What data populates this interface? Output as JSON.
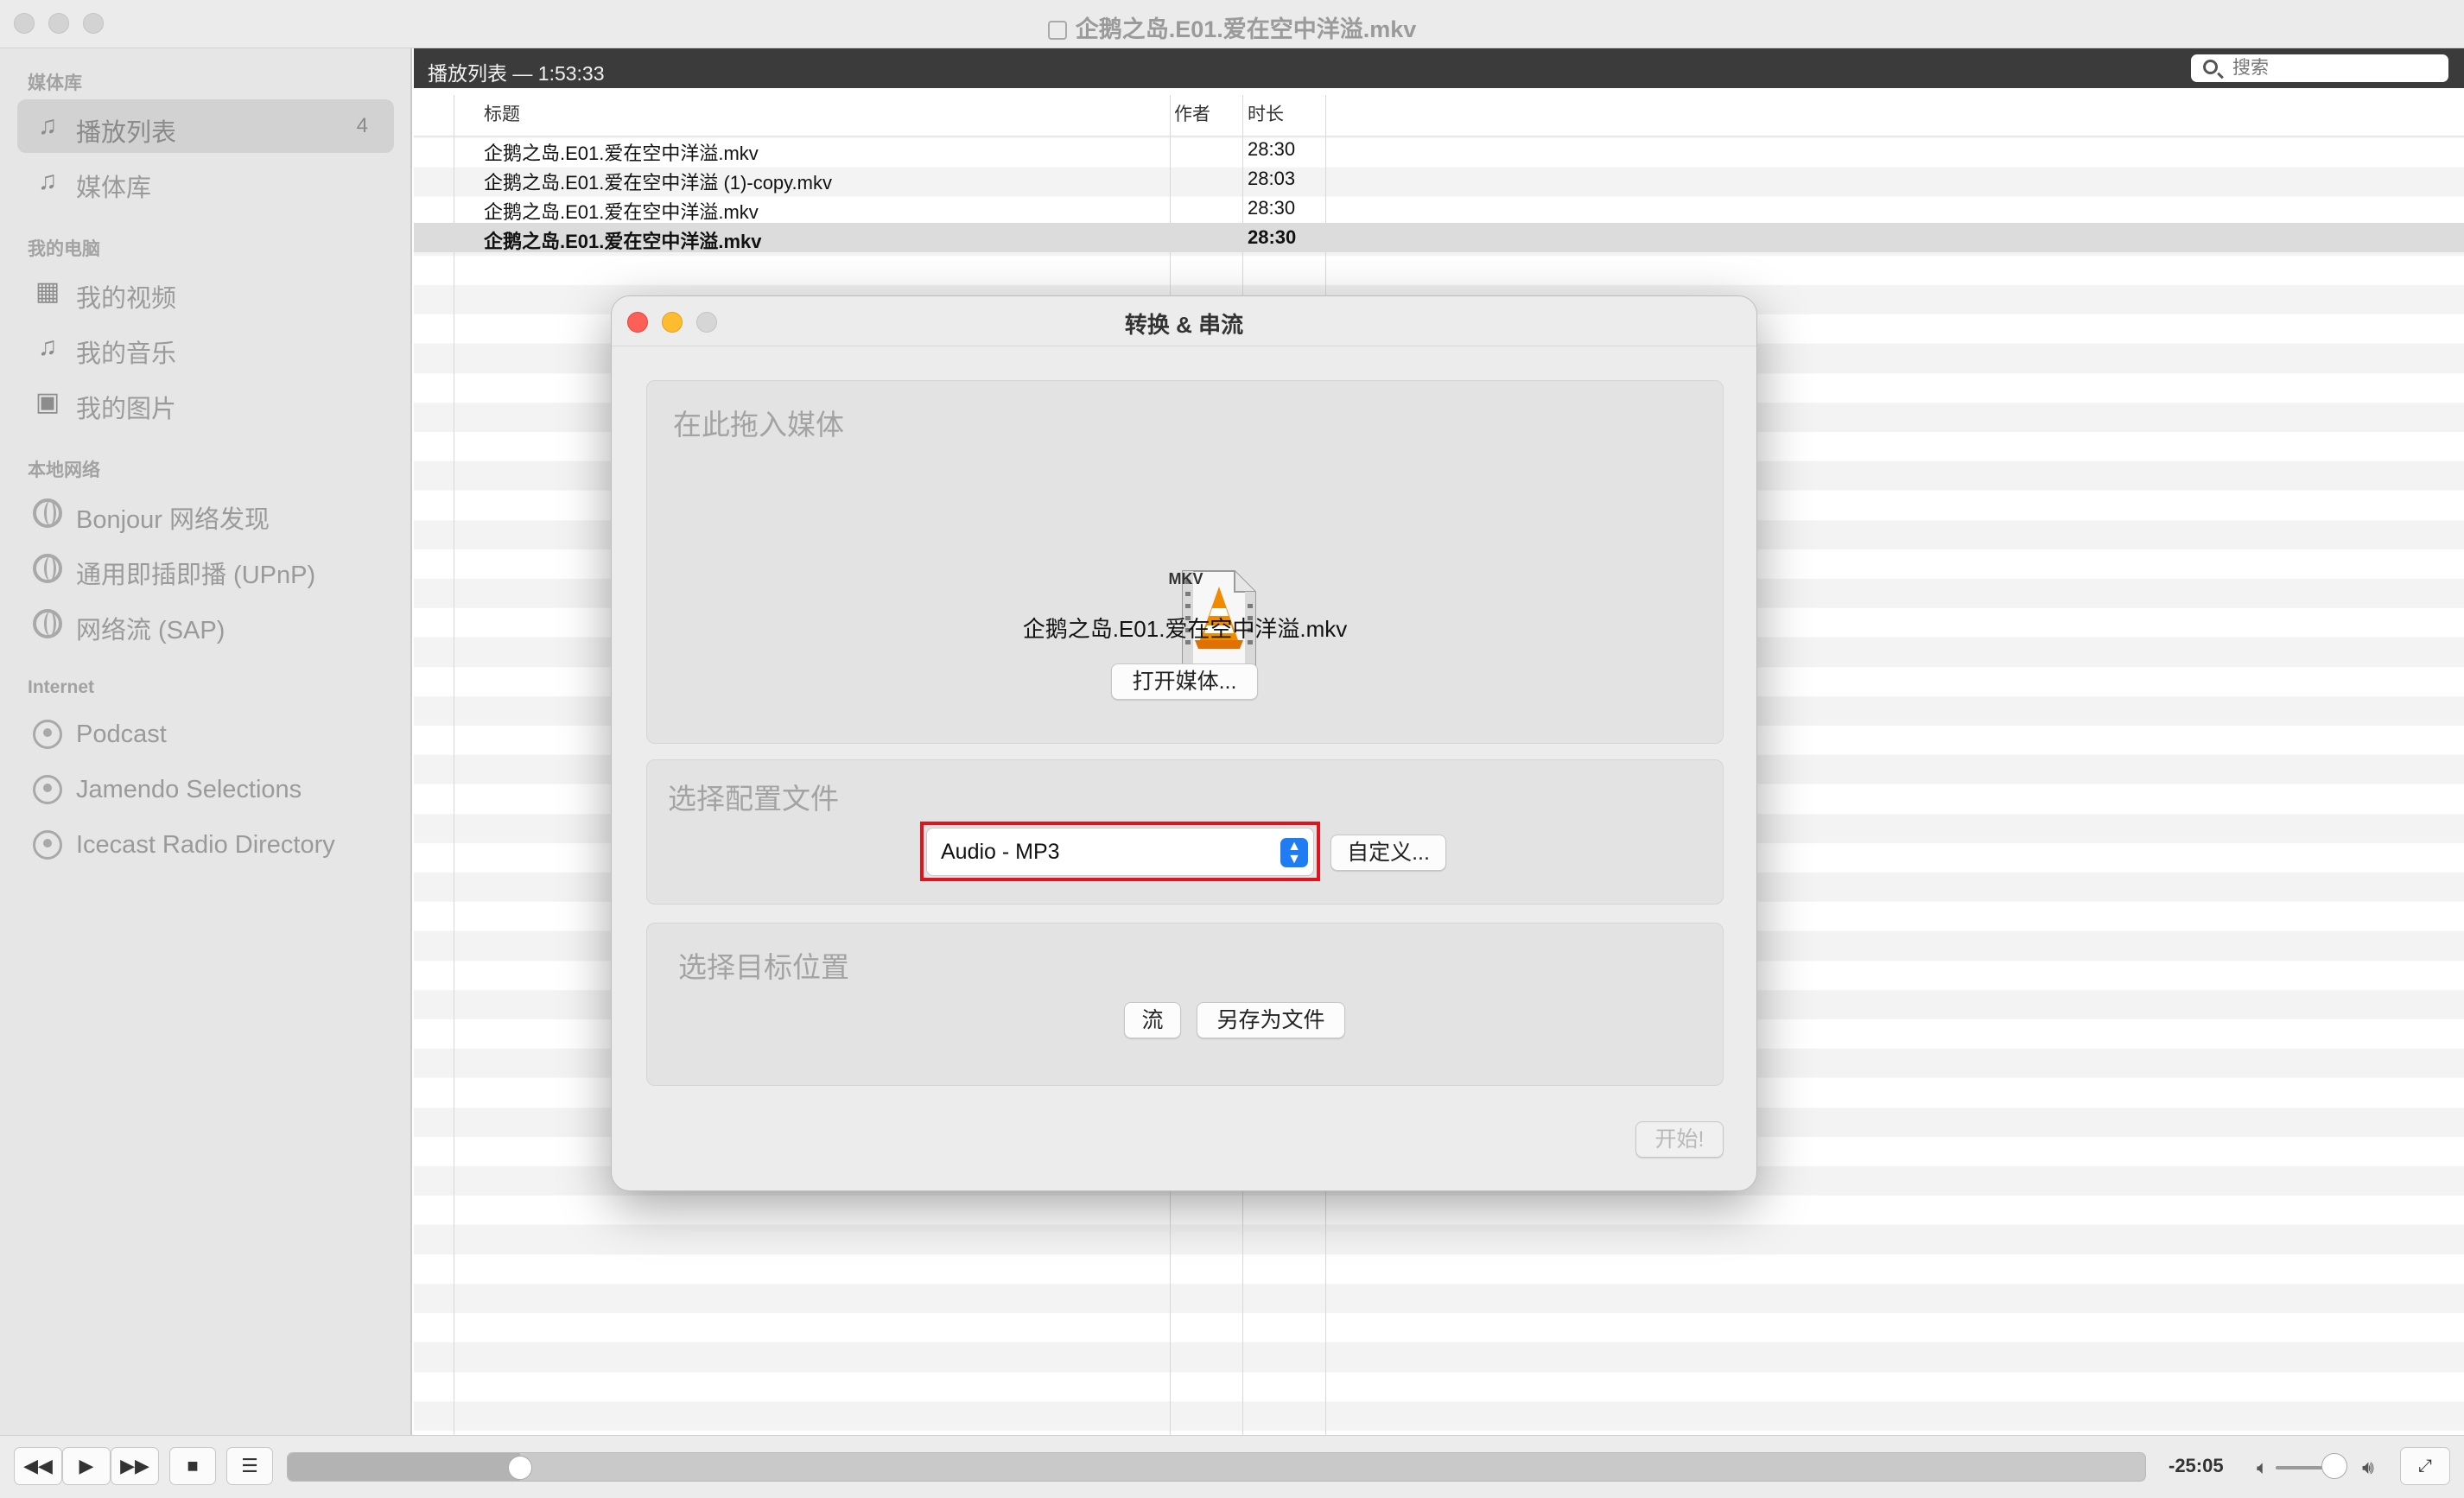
{
  "window": {
    "title": "企鹅之岛.E01.爱在空中洋溢.mkv"
  },
  "sidebar": {
    "sections": [
      {
        "heading": "媒体库",
        "items": [
          {
            "label": "播放列表",
            "icon": "music-note-doc-icon",
            "count": "4",
            "active": true
          },
          {
            "label": "媒体库",
            "icon": "music-note-doc-icon"
          }
        ]
      },
      {
        "heading": "我的电脑",
        "items": [
          {
            "label": "我的视频",
            "icon": "film-icon"
          },
          {
            "label": "我的音乐",
            "icon": "music-note-icon"
          },
          {
            "label": "我的图片",
            "icon": "picture-icon"
          }
        ]
      },
      {
        "heading": "本地网络",
        "items": [
          {
            "label": "Bonjour 网络发现",
            "icon": "globe-icon"
          },
          {
            "label": "通用即插即播 (UPnP)",
            "icon": "globe-icon"
          },
          {
            "label": "网络流 (SAP)",
            "icon": "globe-icon"
          }
        ]
      },
      {
        "heading": "Internet",
        "items": [
          {
            "label": "Podcast",
            "icon": "podcast-icon"
          },
          {
            "label": "Jamendo Selections",
            "icon": "podcast-icon"
          },
          {
            "label": "Icecast Radio Directory",
            "icon": "podcast-icon"
          }
        ]
      }
    ]
  },
  "playlist": {
    "header_title": "播放列表 — 1:53:33",
    "search_placeholder": "搜索",
    "columns": {
      "title": "标题",
      "author": "作者",
      "duration": "时长"
    },
    "rows": [
      {
        "title": "企鹅之岛.E01.爱在空中洋溢.mkv",
        "author": "",
        "duration": "28:30",
        "selected": false
      },
      {
        "title": "企鹅之岛.E01.爱在空中洋溢 (1)-copy.mkv",
        "author": "",
        "duration": "28:03",
        "selected": false
      },
      {
        "title": "企鹅之岛.E01.爱在空中洋溢.mkv",
        "author": "",
        "duration": "28:30",
        "selected": false
      },
      {
        "title": "企鹅之岛.E01.爱在空中洋溢.mkv",
        "author": "",
        "duration": "28:30",
        "selected": true
      }
    ]
  },
  "dialog": {
    "title": "转换 & 串流",
    "drop_section": {
      "label": "在此拖入媒体",
      "file_type": "MKV",
      "file_name": "企鹅之岛.E01.爱在空中洋溢.mkv",
      "open_button": "打开媒体..."
    },
    "profile_section": {
      "label": "选择配置文件",
      "selected_profile": "Audio - MP3",
      "customize_button": "自定义..."
    },
    "destination_section": {
      "label": "选择目标位置",
      "stream_button": "流",
      "save_file_button": "另存为文件"
    },
    "start_button": "开始!"
  },
  "controls": {
    "remaining_time": "-25:05",
    "progress_fraction": 0.125,
    "volume_fraction": 0.85
  },
  "colors": {
    "accent": "#1f7cf2",
    "highlight_box": "#e0141e",
    "header_bar": "#3b3b3b"
  }
}
